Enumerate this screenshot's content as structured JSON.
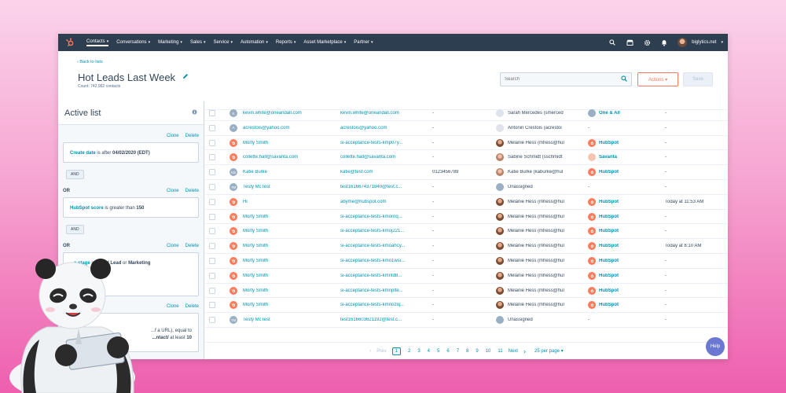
{
  "nav": {
    "items": [
      {
        "label": "Contacts",
        "active": true
      },
      {
        "label": "Conversations"
      },
      {
        "label": "Marketing"
      },
      {
        "label": "Sales"
      },
      {
        "label": "Service"
      },
      {
        "label": "Automation"
      },
      {
        "label": "Reports"
      },
      {
        "label": "Asset Marketplace"
      },
      {
        "label": "Partner"
      }
    ],
    "account": "biglytics.net"
  },
  "header": {
    "back": "‹ Back to lists",
    "title": "Hot Leads Last Week",
    "count": "Count: 742,962 contacts",
    "search_placeholder": "Search",
    "actions": "Actions ▾",
    "save": "Save"
  },
  "panel": {
    "title": "Active list",
    "clone": "Clone",
    "delete": "Delete",
    "or": "OR",
    "and": "AND",
    "filters": [
      {
        "prop": "Create date",
        "rest": " is after ",
        "value": "04/02/2020 (EDT)"
      },
      {
        "prop": "HubSpot score",
        "rest": " is greater than ",
        "value": "150"
      },
      {
        "prop": "...e stage",
        "rest": " is any of ",
        "value": "Lead",
        "rest2": " or ",
        "value2": "Marketing"
      },
      {
        "line1": "...f a URL), equal to",
        "line2a": "...ntact/",
        "line2b": " at least ",
        "line2c": "10"
      }
    ]
  },
  "rows": [
    {
      "av": "K",
      "avc": "gray",
      "name": "kevin.white@oneandall.com",
      "email": "kevin.white@oneandall.com",
      "phone": "-",
      "ownav": "person",
      "owner": "Sarah Mercedes (smerced",
      "co": "gray",
      "company": "One & All",
      "activity": "-"
    },
    {
      "av": "A",
      "avc": "gray",
      "name": "acrestois@yahoo.com",
      "email": "acrestois@yahoo.com",
      "phone": "-",
      "ownav": "person",
      "owner": "Antonin Crestois (acrestoi",
      "co": "",
      "company": "-",
      "activity": "-"
    },
    {
      "av": "",
      "avc": "orange",
      "name": "Morty Smith",
      "email": "si-acceptance-tests-kmp07y...",
      "phone": "-",
      "ownav": "face",
      "owner": "Melanie Hess (mhess@hul",
      "co": "hub",
      "company": "HubSpot",
      "activity": "-"
    },
    {
      "av": "",
      "avc": "orange",
      "name": "collette.hall@savanta.com",
      "email": "collette.hall@savanta.com",
      "phone": "-",
      "ownav": "face2",
      "owner": "Sabine Schmidt (sschmidt",
      "co": "savanta",
      "company": "Savanta",
      "activity": "-"
    },
    {
      "av": "KB",
      "avc": "gray",
      "name": "Katie Burke",
      "email": "katie@test.com",
      "phone": "0123456789",
      "ownav": "face2",
      "owner": "Katie Burke (kaburke@hul",
      "co": "hub",
      "company": "HubSpot",
      "activity": "-"
    },
    {
      "av": "TM",
      "avc": "gray",
      "name": "Testy McTest",
      "email": "test1616674371840@test.c...",
      "phone": "-",
      "ownav": "gray",
      "owner": "Unassigned",
      "co": "",
      "company": "-",
      "activity": "-"
    },
    {
      "av": "",
      "avc": "orange",
      "name": "Hi",
      "email": "abyme@hubspot.com",
      "phone": "-",
      "ownav": "face",
      "owner": "Melanie Hess (mhess@hul",
      "co": "hub",
      "company": "HubSpot",
      "activity": "Today at 11:53 AM"
    },
    {
      "av": "",
      "avc": "orange",
      "name": "Morty Smith",
      "email": "si-acceptance-tests-kmornq...",
      "phone": "-",
      "ownav": "face",
      "owner": "Melanie Hess (mhess@hul",
      "co": "hub",
      "company": "HubSpot",
      "activity": "-"
    },
    {
      "av": "",
      "avc": "orange",
      "name": "Morty Smith",
      "email": "si-acceptance-tests-kmoj221...",
      "phone": "-",
      "ownav": "face",
      "owner": "Melanie Hess (mhess@hul",
      "co": "hub",
      "company": "HubSpot",
      "activity": "-"
    },
    {
      "av": "",
      "avc": "orange",
      "name": "Morty Smith",
      "email": "si-acceptance-tests-kmoahcy...",
      "phone": "-",
      "ownav": "face",
      "owner": "Melanie Hess (mhess@hul",
      "co": "hub",
      "company": "HubSpot",
      "activity": "Today at 8:10 AM"
    },
    {
      "av": "",
      "avc": "orange",
      "name": "Morty Smith",
      "email": "si-acceptance-tests-kmo1wsi...",
      "phone": "-",
      "ownav": "face",
      "owner": "Melanie Hess (mhess@hul",
      "co": "hub",
      "company": "HubSpot",
      "activity": "-"
    },
    {
      "av": "",
      "avc": "orange",
      "name": "Morty Smith",
      "email": "si-acceptance-tests-kmntd8...",
      "phone": "-",
      "ownav": "face",
      "owner": "Melanie Hess (mhess@hul",
      "co": "hub",
      "company": "HubSpot",
      "activity": "-"
    },
    {
      "av": "",
      "avc": "orange",
      "name": "Morty Smith",
      "email": "si-acceptance-tests-kmnplte...",
      "phone": "-",
      "ownav": "face",
      "owner": "Melanie Hess (mhess@hul",
      "co": "hub",
      "company": "HubSpot",
      "activity": "-"
    },
    {
      "av": "",
      "avc": "orange",
      "name": "Morty Smith",
      "email": "si-acceptance-tests-kmnozlq...",
      "phone": "-",
      "ownav": "face",
      "owner": "Melanie Hess (mhess@hul",
      "co": "hub",
      "company": "HubSpot",
      "activity": "-"
    },
    {
      "av": "TM",
      "avc": "gray",
      "name": "Testy McTest",
      "email": "test1616603621192@test.c...",
      "phone": "-",
      "ownav": "gray",
      "owner": "Unassigned",
      "co": "",
      "company": "-",
      "activity": "-"
    }
  ],
  "pagination": {
    "prev": "Prev",
    "pages": [
      "1",
      "2",
      "3",
      "4",
      "5",
      "6",
      "7",
      "8",
      "9",
      "10",
      "11"
    ],
    "current": "1",
    "next": "Next",
    "per_page": "25 per page ▾"
  },
  "help": "Help",
  "colors": {
    "nav_bg": "#2d3e50",
    "accent": "#ff7a59",
    "link": "#0091ae"
  }
}
